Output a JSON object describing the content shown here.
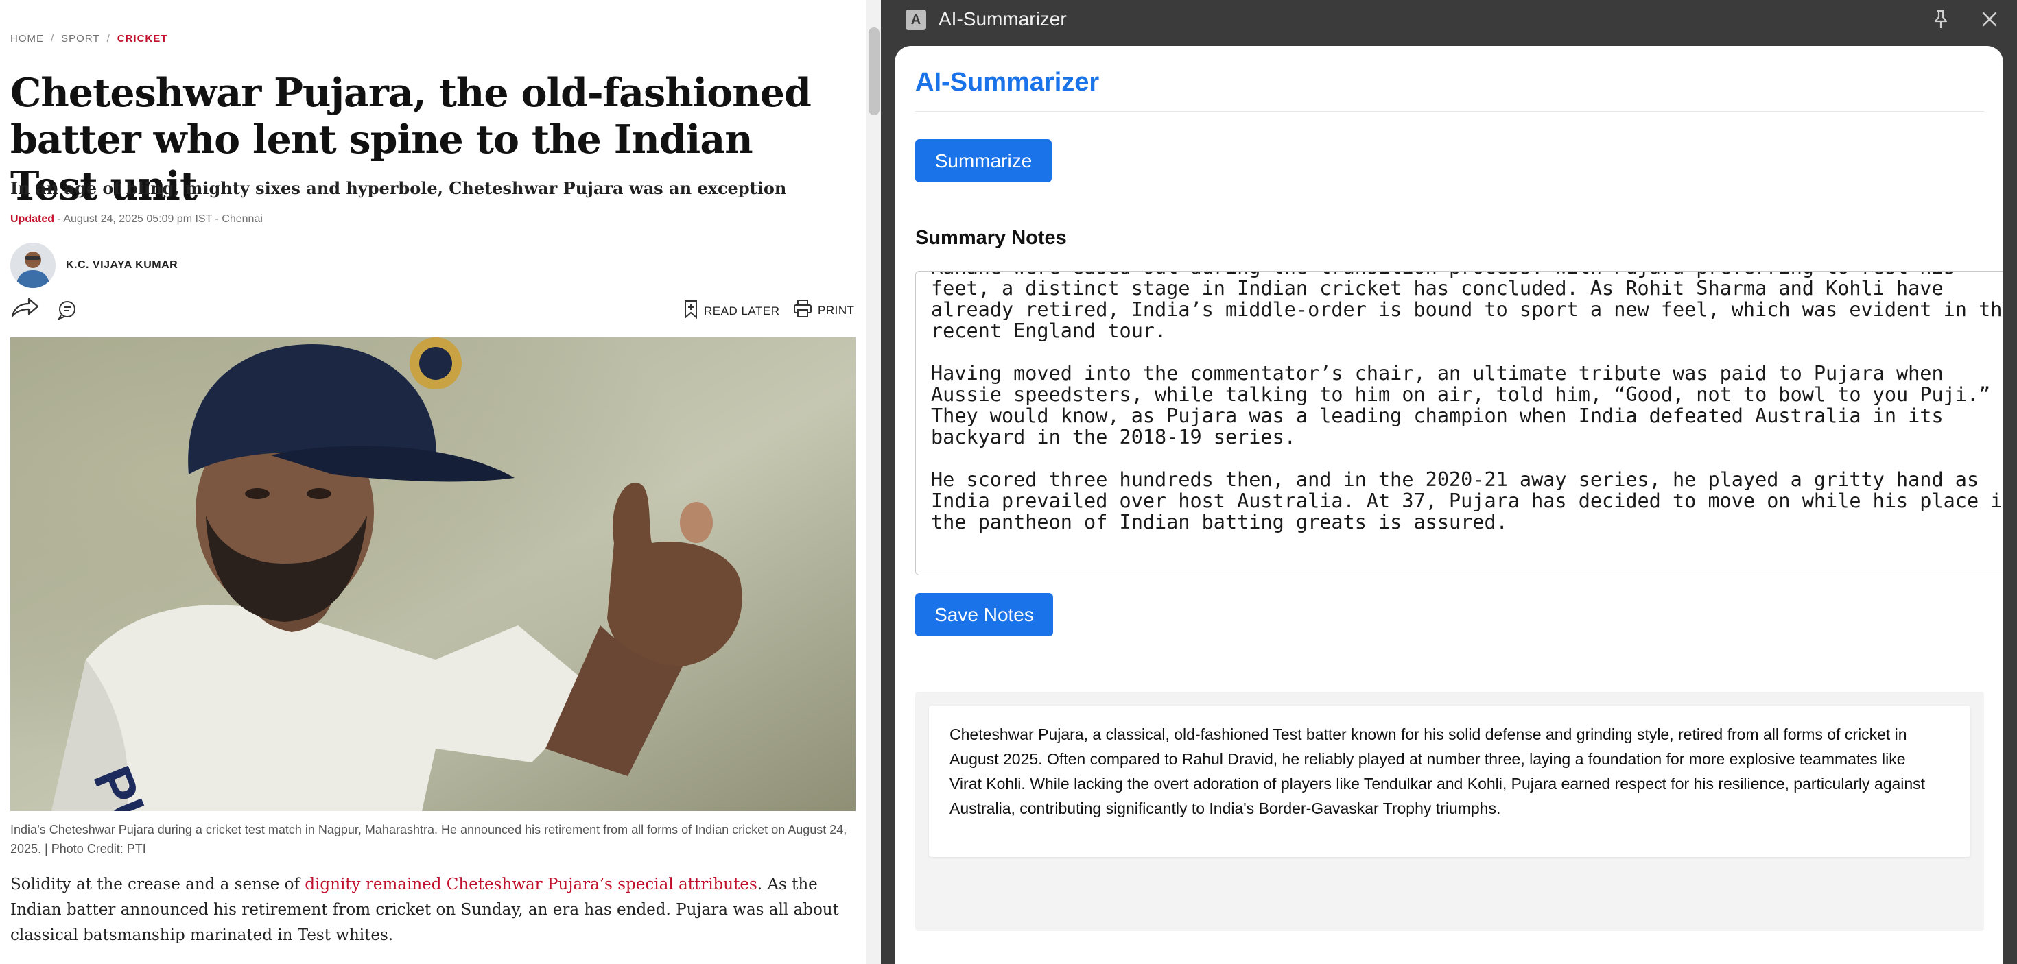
{
  "article": {
    "breadcrumb": [
      "HOME",
      "SPORT",
      "CRICKET"
    ],
    "headline": "Cheteshwar Pujara, the old-fashioned batter who lent spine to the Indian Test unit",
    "subhead": "In an age of bling, mighty sixes and hyperbole, Cheteshwar Pujara was an exception",
    "updated_label": "Updated",
    "updated_meta": " - August 24, 2025 05:09 pm IST - Chennai",
    "author": "K.C. VIJAYA KUMAR",
    "read_later": "READ LATER",
    "print": "PRINT",
    "image_jersey_text": "PUJARA",
    "caption": "India’s Cheteshwar Pujara during a cricket test match in Nagpur, Maharashtra. He announced his retirement from all forms of Indian cricket on August 24, 2025. | Photo Credit: PTI",
    "body_pre": "Solidity at the crease and a sense of ",
    "body_link": "dignity remained Cheteshwar Pujara’s special attributes",
    "body_post": ". As the Indian batter announced his retirement from cricket on Sunday, an era has ended. Pujara was all about classical batsmanship marinated in Test whites.",
    "colors": {
      "accent": "#c0102b"
    }
  },
  "panel": {
    "window_title": "AI-Summarizer",
    "app_icon_letter": "A",
    "heading": "AI-Summarizer",
    "summarize_label": "Summarize",
    "notes_label": "Summary Notes",
    "notes_text": "Rahane were eased out during the transition process. With Pujara preferring to rest his feet, a distinct stage in Indian cricket has concluded. As Rohit Sharma and Kohli have already retired, India’s middle-order is bound to sport a new feel, which was evident in the recent England tour.\n\nHaving moved into the commentator’s chair, an ultimate tribute was paid to Pujara when Aussie speedsters, while talking to him on air, told him, “Good, not to bowl to you Puji.” They would know, as Pujara was a leading champion when India defeated Australia in its backyard in the 2018-19 series.\n\nHe scored three hundreds then, and in the 2020-21 away series, he played a gritty hand as India prevailed over host Australia. At 37, Pujara has decided to move on while his place in the pantheon of Indian batting greats is assured.",
    "save_label": "Save Notes",
    "summary": "Cheteshwar Pujara, a classical, old-fashioned Test batter known for his solid defense and grinding style, retired from all forms of cricket in August 2025. Often compared to Rahul Dravid, he reliably played at number three, laying a foundation for more explosive teammates like Virat Kohli. While lacking the overt adoration of players like Tendulkar and Kohli, Pujara earned respect for his resilience, particularly against Australia, contributing significantly to India's Border-Gavaskar Trophy triumphs.",
    "colors": {
      "primary": "#1a73e8",
      "titlebar": "#3b3b3b"
    },
    "icons": {
      "pin": "pin-icon",
      "close": "close-icon"
    }
  }
}
